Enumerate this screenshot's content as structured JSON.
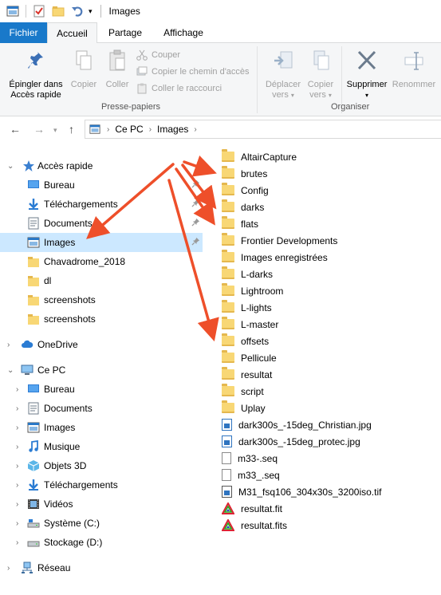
{
  "window": {
    "title": "Images"
  },
  "tabs": {
    "file": "Fichier",
    "home": "Accueil",
    "share": "Partage",
    "view": "Affichage"
  },
  "ribbon": {
    "pin": "Épingler dans\nAccès rapide",
    "copy": "Copier",
    "paste": "Coller",
    "cut": "Couper",
    "copy_path": "Copier le chemin d'accès",
    "paste_shortcut": "Coller le raccourci",
    "clipboard_group": "Presse-papiers",
    "move_to": "Déplacer",
    "move_to_sub": "vers",
    "copy_to": "Copier",
    "copy_to_sub": "vers",
    "delete": "Supprimer",
    "rename": "Renommer",
    "organize_group": "Organiser"
  },
  "address": {
    "crumbs": [
      "Ce PC",
      "Images"
    ]
  },
  "navpane": {
    "quick_access": "Accès rapide",
    "quick_items": [
      {
        "label": "Bureau",
        "icon": "desktop-icon",
        "pinned": true
      },
      {
        "label": "Téléchargements",
        "icon": "download-icon",
        "pinned": true
      },
      {
        "label": "Documents",
        "icon": "documents-icon",
        "pinned": true
      },
      {
        "label": "Images",
        "icon": "pictures-icon",
        "pinned": true,
        "selected": true
      },
      {
        "label": "Chavadrome_2018",
        "icon": "folder-icon"
      },
      {
        "label": "dl",
        "icon": "folder-icon"
      },
      {
        "label": "screenshots",
        "icon": "folder-icon"
      },
      {
        "label": "screenshots",
        "icon": "folder-icon"
      }
    ],
    "onedrive": "OneDrive",
    "this_pc": "Ce PC",
    "pc_items": [
      {
        "label": "Bureau",
        "icon": "desktop-icon"
      },
      {
        "label": "Documents",
        "icon": "documents-icon"
      },
      {
        "label": "Images",
        "icon": "pictures-icon"
      },
      {
        "label": "Musique",
        "icon": "music-icon"
      },
      {
        "label": "Objets 3D",
        "icon": "objects-3d-icon"
      },
      {
        "label": "Téléchargements",
        "icon": "download-icon"
      },
      {
        "label": "Vidéos",
        "icon": "videos-icon"
      },
      {
        "label": "Système (C:)",
        "icon": "system-drive-icon"
      },
      {
        "label": "Stockage (D:)",
        "icon": "drive-icon"
      }
    ],
    "network": "Réseau"
  },
  "files": [
    {
      "name": "AltairCapture",
      "type": "folder"
    },
    {
      "name": "brutes",
      "type": "folder"
    },
    {
      "name": "Config",
      "type": "folder"
    },
    {
      "name": "darks",
      "type": "folder"
    },
    {
      "name": "flats",
      "type": "folder"
    },
    {
      "name": "Frontier Developments",
      "type": "folder"
    },
    {
      "name": "Images enregistrées",
      "type": "folder"
    },
    {
      "name": "L-darks",
      "type": "folder"
    },
    {
      "name": "Lightroom",
      "type": "folder"
    },
    {
      "name": "L-lights",
      "type": "folder"
    },
    {
      "name": "L-master",
      "type": "folder"
    },
    {
      "name": "offsets",
      "type": "folder"
    },
    {
      "name": "Pellicule",
      "type": "folder"
    },
    {
      "name": "resultat",
      "type": "folder"
    },
    {
      "name": "script",
      "type": "folder"
    },
    {
      "name": "Uplay",
      "type": "folder"
    },
    {
      "name": "dark300s_-15deg_Christian.jpg",
      "type": "image"
    },
    {
      "name": "dark300s_-15deg_protec.jpg",
      "type": "image"
    },
    {
      "name": "m33-.seq",
      "type": "file"
    },
    {
      "name": "m33_.seq",
      "type": "file"
    },
    {
      "name": "M31_fsq106_304x30s_3200iso.tif",
      "type": "tif"
    },
    {
      "name": "resultat.fit",
      "type": "fits"
    },
    {
      "name": "resultat.fits",
      "type": "fits"
    }
  ],
  "colors": {
    "accent": "#1979ca",
    "selection": "#cce8ff",
    "arrow": "#ee4f2a"
  }
}
